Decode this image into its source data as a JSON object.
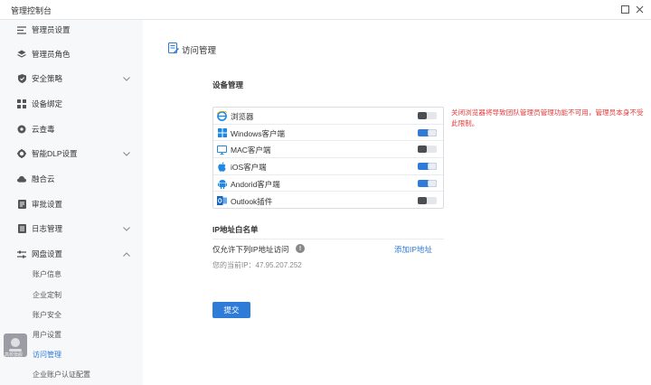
{
  "window": {
    "title": "管理控制台"
  },
  "sidebar": {
    "items": [
      {
        "label": "管理员设置",
        "icon": "list-lines-icon",
        "expandable": false
      },
      {
        "label": "管理员角色",
        "icon": "stack-layers-icon",
        "expandable": false
      },
      {
        "label": "安全策略",
        "icon": "shield-icon",
        "expandable": true
      },
      {
        "label": "设备绑定",
        "icon": "device-bind-icon",
        "expandable": false
      },
      {
        "label": "云查毒",
        "icon": "virus-scan-icon",
        "expandable": false
      },
      {
        "label": "智能DLP设置",
        "icon": "gear-icon",
        "expandable": true
      },
      {
        "label": "融合云",
        "icon": "cloud-icon",
        "expandable": false
      },
      {
        "label": "审批设置",
        "icon": "approval-icon",
        "expandable": false
      },
      {
        "label": "日志管理",
        "icon": "log-icon",
        "expandable": true
      },
      {
        "label": "网盘设置",
        "icon": "sliders-icon",
        "expandable": true,
        "expanded": true
      }
    ],
    "sub_items": [
      {
        "label": "账户信息"
      },
      {
        "label": "企业定制"
      },
      {
        "label": "账户安全"
      },
      {
        "label": "用户设置"
      },
      {
        "label": "访问管理",
        "active": true
      },
      {
        "label": "企业账户认证配置"
      }
    ],
    "avatar_text": "高校旗舰"
  },
  "main": {
    "page_title": "访问管理",
    "device_section": {
      "title": "设备管理",
      "devices": [
        {
          "label": "浏览器",
          "icon": "ie-browser-icon",
          "enabled": false
        },
        {
          "label": "Windows客户端",
          "icon": "windows-icon",
          "enabled": true
        },
        {
          "label": "MAC客户端",
          "icon": "monitor-icon",
          "enabled": false
        },
        {
          "label": "iOS客户端",
          "icon": "apple-icon",
          "enabled": true
        },
        {
          "label": "Andorid客户端",
          "icon": "android-icon",
          "enabled": true
        },
        {
          "label": "Outlook插件",
          "icon": "outlook-icon",
          "enabled": false
        }
      ],
      "warning": "关闭浏览器将导致团队管理员管理功能不可用，管理员本身不受此限制。"
    },
    "ip_section": {
      "title": "IP地址白名单",
      "allow_label": "仅允许下列IP地址访问",
      "add_link": "添加IP地址",
      "current_ip": "您的当前IP：47.95.207.252"
    },
    "submit_label": "提交"
  },
  "colors": {
    "accent": "#2f7bd8",
    "warning": "#e53b3b",
    "sidebar_bg": "#f7f8fa"
  }
}
